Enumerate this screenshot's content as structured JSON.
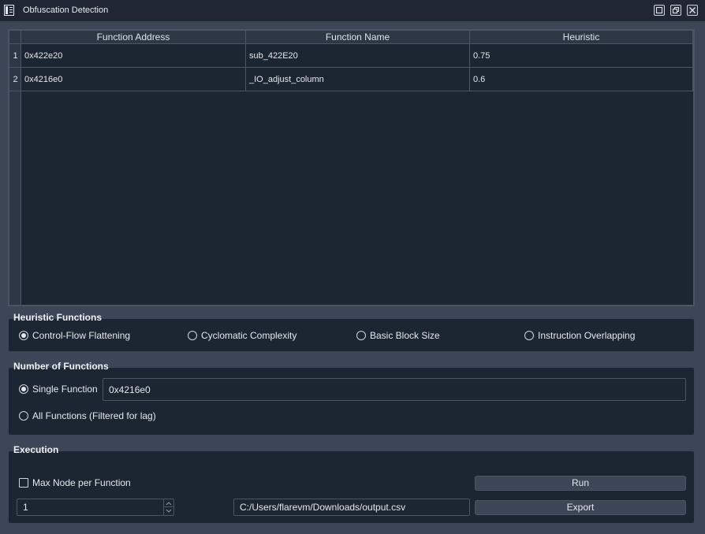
{
  "window": {
    "title": "Obfuscation Detection"
  },
  "table": {
    "headers": [
      "Function Address",
      "Function Name",
      "Heuristic"
    ],
    "rows": [
      {
        "index": "1",
        "address": "0x422e20",
        "name": "sub_422E20",
        "heuristic": "0.75"
      },
      {
        "index": "2",
        "address": "0x4216e0",
        "name": "_IO_adjust_column",
        "heuristic": "0.6"
      }
    ]
  },
  "heuristic_functions": {
    "title": "Heuristic Functions",
    "options": [
      {
        "label": "Control-Flow Flattening",
        "selected": true
      },
      {
        "label": "Cyclomatic Complexity",
        "selected": false
      },
      {
        "label": "Basic Block Size",
        "selected": false
      },
      {
        "label": "Instruction Overlapping",
        "selected": false
      }
    ]
  },
  "number_of_functions": {
    "title": "Number of Functions",
    "single_label": "Single Function",
    "single_selected": true,
    "single_value": "0x4216e0",
    "all_label": "All Functions (Filtered for lag)",
    "all_selected": false
  },
  "execution": {
    "title": "Execution",
    "max_node_label": "Max Node per Function",
    "max_node_checked": false,
    "spin_value": "1",
    "output_path": "C:/Users/flarevm/Downloads/output.csv",
    "run_label": "Run",
    "export_label": "Export"
  },
  "colors": {
    "background": "#3c4656",
    "panel": "#1c2632",
    "titlebar": "#1e2733",
    "border": "#4b5566",
    "text": "#e6e8eb"
  },
  "icons": {
    "app": "window-app-icon",
    "maximize": "maximize-icon",
    "restore": "restore-icon",
    "close": "close-icon"
  }
}
